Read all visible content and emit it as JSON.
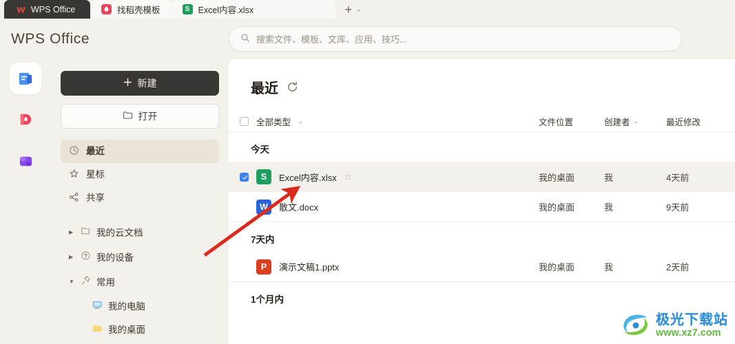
{
  "tabs": [
    {
      "label": "WPS Office",
      "icon": "wps-logo-icon",
      "active": true
    },
    {
      "label": "找稻壳模板",
      "icon": "docer-icon",
      "active": false
    },
    {
      "label": "Excel内容.xlsx",
      "icon": "excel-icon",
      "active": false
    }
  ],
  "tabbar": {
    "new_tab_label": "+",
    "dropdown_label": "⌄"
  },
  "header": {
    "brand": "WPS Office",
    "search_placeholder": "搜索文件、模板、文库、应用、技巧..."
  },
  "rail": [
    {
      "name": "documents-app-icon",
      "color": "#3b7fe0",
      "active": true
    },
    {
      "name": "docer-app-icon",
      "color": "#e8455b",
      "active": false
    },
    {
      "name": "apps-grid-icon",
      "color": "#8b4ae8",
      "active": false
    }
  ],
  "sidebar": {
    "new_button": "新建",
    "open_button": "打开",
    "nav": [
      {
        "label": "最近",
        "icon": "clock-icon",
        "selected": true
      },
      {
        "label": "星标",
        "icon": "star-icon",
        "selected": false
      },
      {
        "label": "共享",
        "icon": "share-icon",
        "selected": false
      }
    ],
    "tree": [
      {
        "label": "我的云文档",
        "icon": "folder-icon",
        "expanded": false,
        "arrow": "▶"
      },
      {
        "label": "我的设备",
        "icon": "cloud-upload-icon",
        "expanded": false,
        "arrow": "▶"
      },
      {
        "label": "常用",
        "icon": "pin-icon",
        "expanded": true,
        "arrow": "▼"
      }
    ],
    "tree_children": [
      {
        "label": "我的电脑",
        "icon": "monitor-icon",
        "color": "#4a90d9"
      },
      {
        "label": "我的桌面",
        "icon": "desktop-folder-icon",
        "color": "#f2d375"
      }
    ]
  },
  "main": {
    "title": "最近",
    "refresh_label": "↻",
    "columns": {
      "type_filter": "全部类型",
      "location": "文件位置",
      "creator": "创建者",
      "modified": "最近修改"
    },
    "groups": [
      {
        "label": "今天",
        "files": [
          {
            "name": "Excel内容.xlsx",
            "icon": "excel-file-icon",
            "icon_letter": "S",
            "location": "我的桌面",
            "creator": "我",
            "modified": "4天前",
            "checked": true,
            "selected": true,
            "starred": false
          },
          {
            "name": "散文.docx",
            "icon": "word-file-icon",
            "icon_letter": "W",
            "location": "我的桌面",
            "creator": "我",
            "modified": "9天前",
            "checked": false,
            "selected": false,
            "starred": false
          }
        ]
      },
      {
        "label": "7天内",
        "files": [
          {
            "name": "演示文稿1.pptx",
            "icon": "powerpoint-file-icon",
            "icon_letter": "P",
            "location": "我的桌面",
            "creator": "我",
            "modified": "2天前",
            "checked": false,
            "selected": false,
            "starred": false
          }
        ]
      },
      {
        "label": "1个月内",
        "files": []
      }
    ]
  },
  "watermark": {
    "cn": "极光下载站",
    "url": "www.xz7.com"
  },
  "colors": {
    "accent_blue": "#3e7ff0",
    "excel_green": "#1d9e5e",
    "word_blue": "#2b63d9",
    "ppt_red": "#d9401f",
    "dark_button": "#3a3633",
    "page_bg": "#f4f1ec",
    "arrow_red": "#d92b1e"
  }
}
